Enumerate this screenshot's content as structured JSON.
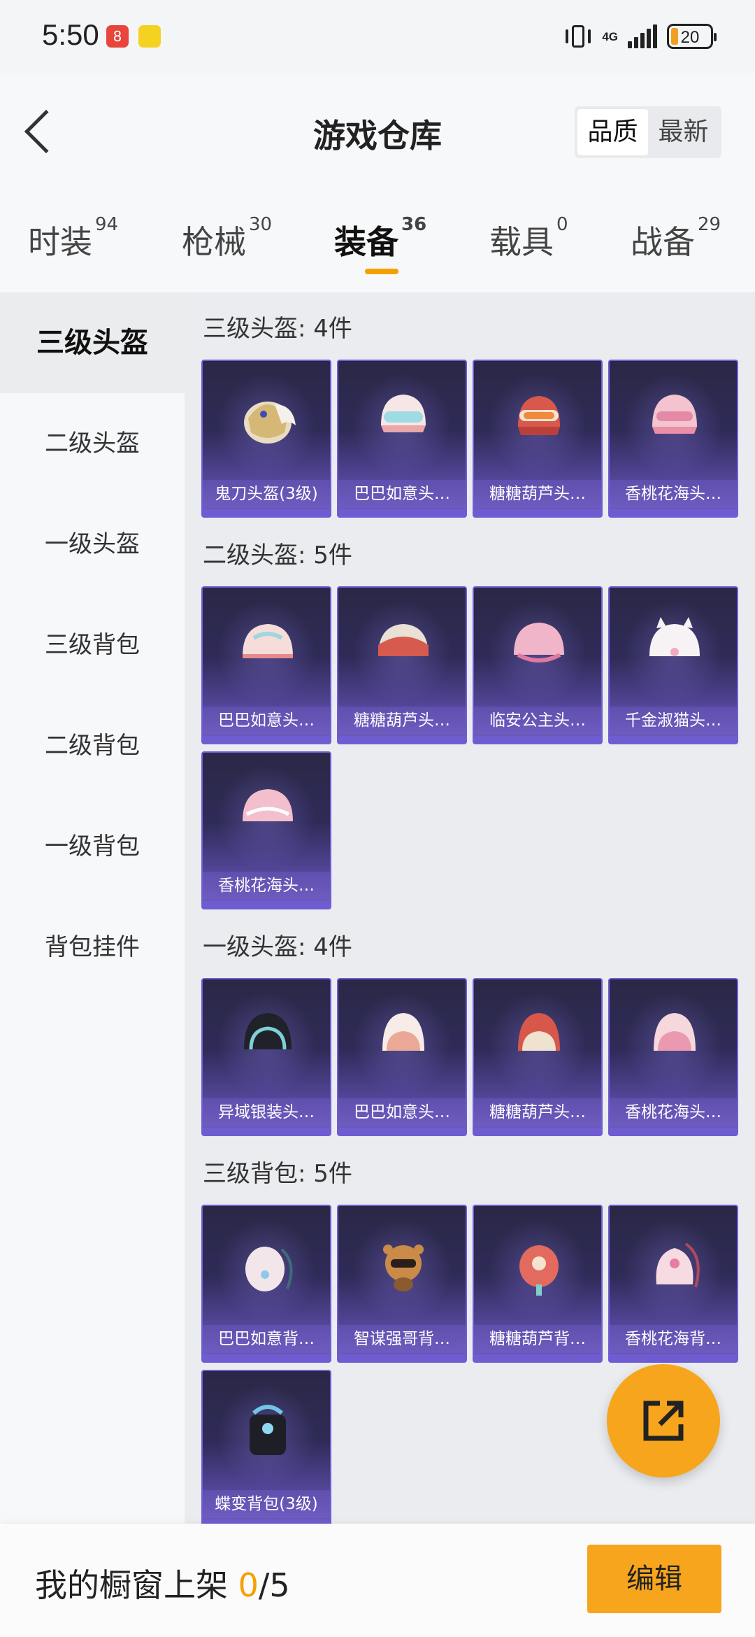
{
  "status_bar": {
    "time": "5:50",
    "network": "4G",
    "battery": "20"
  },
  "header": {
    "title": "游戏仓库",
    "sort_options": [
      "品质",
      "最新"
    ],
    "sort_selected": "品质"
  },
  "tabs": [
    {
      "label": "时装",
      "count": "94"
    },
    {
      "label": "枪械",
      "count": "30"
    },
    {
      "label": "装备",
      "count": "36",
      "active": true
    },
    {
      "label": "载具",
      "count": "0"
    },
    {
      "label": "战备",
      "count": "29"
    }
  ],
  "sidebar": {
    "items": [
      "三级头盔",
      "二级头盔",
      "一级头盔",
      "三级背包",
      "二级背包",
      "一级背包",
      "背包挂件"
    ],
    "active": "三级头盔"
  },
  "sections": [
    {
      "title": "三级头盔: 4件",
      "items": [
        "鬼刀头盔(3级)",
        "巴巴如意头…",
        "糖糖葫芦头…",
        "香桃花海头…"
      ],
      "icons": [
        "helmet-gold-icon",
        "helmet-pink-goggles-icon",
        "helmet-red-goggles-icon",
        "helmet-pink-icon"
      ]
    },
    {
      "title": "二级头盔: 5件",
      "items": [
        "巴巴如意头…",
        "糖糖葫芦头…",
        "临安公主头…",
        "千金淑猫头…",
        "香桃花海头…"
      ],
      "icons": [
        "helmet-pink-icon",
        "helmet-red-icon",
        "helmet-pink-icon",
        "helmet-white-cat-icon",
        "helmet-pink-icon"
      ]
    },
    {
      "title": "一级头盔: 4件",
      "items": [
        "异域银装头…",
        "巴巴如意头…",
        "糖糖葫芦头…",
        "香桃花海头…"
      ],
      "icons": [
        "helmet-black-icon",
        "helmet-pink-icon",
        "helmet-red-icon",
        "helmet-pink-icon"
      ]
    },
    {
      "title": "三级背包: 5件",
      "items": [
        "巴巴如意背…",
        "智谋强哥背…",
        "糖糖葫芦背…",
        "香桃花海背…",
        "蝶变背包(3级)"
      ],
      "icons": [
        "backpack-white-icon",
        "backpack-bear-icon",
        "backpack-red-icon",
        "backpack-pink-icon",
        "backpack-black-icon"
      ]
    }
  ],
  "bottom_bar": {
    "label": "我的橱窗上架",
    "count_current": "0",
    "count_total": "/5",
    "edit_label": "编辑"
  },
  "colors": {
    "accent": "#f7a51c",
    "card_border": "#6d5ed6"
  }
}
